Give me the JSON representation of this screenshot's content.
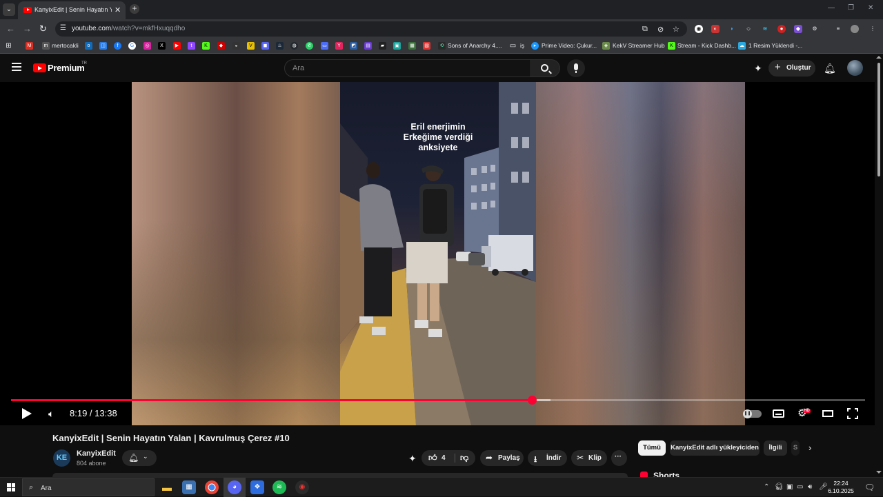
{
  "browser": {
    "tab_title": "KanyixEdit | Senin Hayatın Yalan",
    "url_host": "youtube.com",
    "url_path": "/watch?v=mkfHxuqqdho",
    "bookmarks": [
      {
        "label": "mertocakli"
      },
      {
        "label": "Sons of Anarchy 4...."
      },
      {
        "label": "iş"
      },
      {
        "label": "Prime Video: Çukur..."
      },
      {
        "label": "KekV Streamer Hub"
      },
      {
        "label": "Stream - Kick Dashb..."
      },
      {
        "label": "1 Resim Yüklendi -..."
      }
    ]
  },
  "header": {
    "brand": "Premium",
    "country": "TR",
    "search_placeholder": "Ara",
    "create_label": "Oluştur"
  },
  "player": {
    "caption_line1": "Eril enerjimin",
    "caption_line2": "Erkeğime verdiği",
    "caption_line3": "anksiyete",
    "current_time": "8:19",
    "duration": "13:38",
    "time_display": "8:19 / 13:38",
    "played_fraction": 0.61,
    "buffered_fraction": 0.632,
    "hd_badge": "HD"
  },
  "video": {
    "title": "KanyixEdit | Senin Hayatın Yalan | Kavrulmuş Çerez #10",
    "channel_name": "KanyixEdit",
    "channel_initials": "KE",
    "subscribers": "804 abone",
    "like_count": "4",
    "share_label": "Paylaş",
    "download_label": "İndir",
    "clip_label": "Klip",
    "more_label": "···"
  },
  "sidebar": {
    "chips": [
      {
        "label": "Tümü",
        "active": true
      },
      {
        "label": "KanyixEdit adlı yükleyiciden",
        "active": false
      },
      {
        "label": "İlgili",
        "active": false
      },
      {
        "label": "S",
        "active": false
      }
    ],
    "shorts_title": "Shorts"
  },
  "taskbar": {
    "search_placeholder": "Ara",
    "time": "22:24",
    "date": "6.10.2025"
  },
  "colors": {
    "accent_red": "#ff0033",
    "background": "#0f0f0f"
  }
}
